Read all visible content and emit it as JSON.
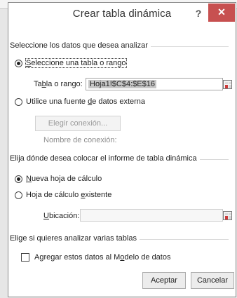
{
  "dialog": {
    "title": "Crear tabla dinámica",
    "help_glyph": "?",
    "close_glyph": "✕"
  },
  "analyze": {
    "heading": "Seleccione los datos que desea analizar",
    "option_table": {
      "key": "S",
      "rest": "eleccione una tabla o rango",
      "selected": true
    },
    "range_label": {
      "pre": "Ta",
      "key": "b",
      "post": "la o rango:"
    },
    "range_value": "Hoja1!$C$4:$E$16",
    "option_external": {
      "pre": "Utilice una fuente ",
      "key": "d",
      "post": "e datos externa",
      "selected": false
    },
    "choose_connection_button": "Elegir conexión...",
    "connection_name_label": "Nombre de conexión:"
  },
  "placement": {
    "heading": "Elija dónde desea colocar el informe de tabla dinámica",
    "option_new": {
      "key": "N",
      "rest": "ueva hoja de cálculo",
      "selected": true
    },
    "option_existing": {
      "pre": "Hoja de cálculo ",
      "key": "e",
      "post": "xistente",
      "selected": false
    },
    "location_label": {
      "key": "U",
      "rest": "bicación:"
    },
    "location_value": ""
  },
  "multiple": {
    "heading": "Elige si quieres analizar varias tablas",
    "checkbox": {
      "pre": "Agregar estos datos al M",
      "key": "o",
      "post": "delo de datos",
      "checked": false
    }
  },
  "footer": {
    "ok_label": "Aceptar",
    "cancel_label": "Cancelar"
  }
}
